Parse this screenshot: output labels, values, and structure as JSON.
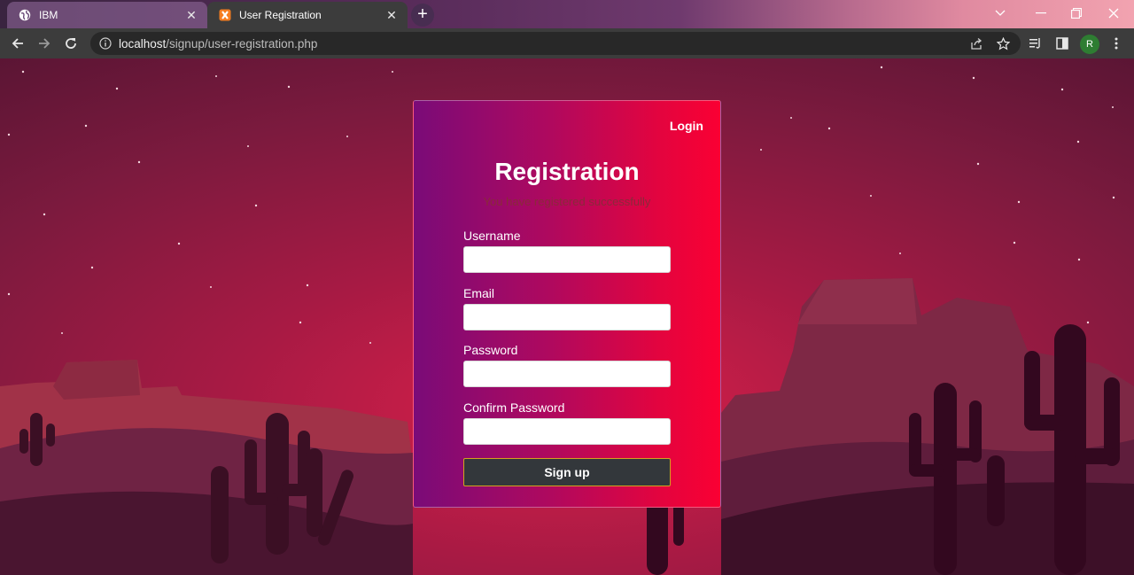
{
  "browser": {
    "tabs": [
      {
        "title": "IBM",
        "active": false,
        "favicon": "globe-icon"
      },
      {
        "title": "User Registration",
        "active": true,
        "favicon": "xampp-icon"
      }
    ],
    "url_host": "localhost",
    "url_path": "/signup/user-registration.php",
    "profile_initial": "R",
    "colors": {
      "profile": "#2e7d32",
      "chrome": "#3c3c3c"
    }
  },
  "form": {
    "login_link": "Login",
    "title": "Registration",
    "message": "You have registered successfully",
    "fields": [
      {
        "label": "Username",
        "value": ""
      },
      {
        "label": "Email",
        "value": ""
      },
      {
        "label": "Password",
        "value": ""
      },
      {
        "label": "Confirm Password",
        "value": ""
      }
    ],
    "submit_label": "Sign up",
    "colors": {
      "gradient_start": "#7a0b78",
      "gradient_end": "#fa0033",
      "button": "#33373b",
      "button_border": "#d4a21e"
    }
  }
}
